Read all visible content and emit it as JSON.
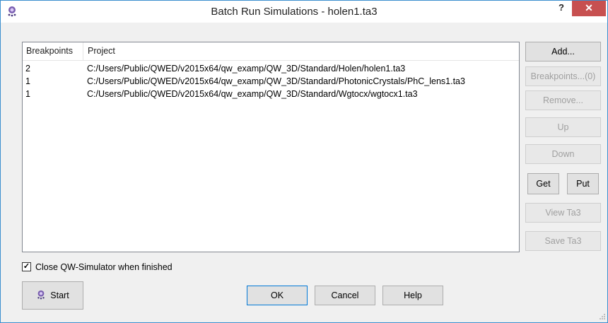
{
  "window": {
    "title": "Batch Run Simulations - holen1.ta3",
    "help_label": "?",
    "close_label": "✕",
    "app_icon": "qw-simulator-icon"
  },
  "list": {
    "columns": [
      "Breakpoints",
      "Project"
    ],
    "rows": [
      {
        "breakpoints": "2",
        "project": "C:/Users/Public/QWED/v2015x64/qw_examp/QW_3D/Standard/Holen/holen1.ta3"
      },
      {
        "breakpoints": "1",
        "project": "C:/Users/Public/QWED/v2015x64/qw_examp/QW_3D/Standard/PhotonicCrystals/PhC_lens1.ta3"
      },
      {
        "breakpoints": "1",
        "project": "C:/Users/Public/QWED/v2015x64/qw_examp/QW_3D/Standard/Wgtocx/wgtocx1.ta3"
      }
    ]
  },
  "side_buttons": {
    "add": "Add...",
    "breakpoints": "Breakpoints...(0)",
    "remove": "Remove...",
    "up": "Up",
    "down": "Down",
    "get": "Get",
    "put": "Put",
    "view": "View Ta3",
    "save": "Save Ta3"
  },
  "options": {
    "close_simulator_label": "Close QW-Simulator when finished",
    "close_simulator_checked": true
  },
  "footer": {
    "start": "Start",
    "ok": "OK",
    "cancel": "Cancel",
    "help": "Help"
  },
  "colors": {
    "close_button": "#c75050",
    "window_border": "#3c8fcf",
    "disabled_text": "#a0a0a0"
  }
}
